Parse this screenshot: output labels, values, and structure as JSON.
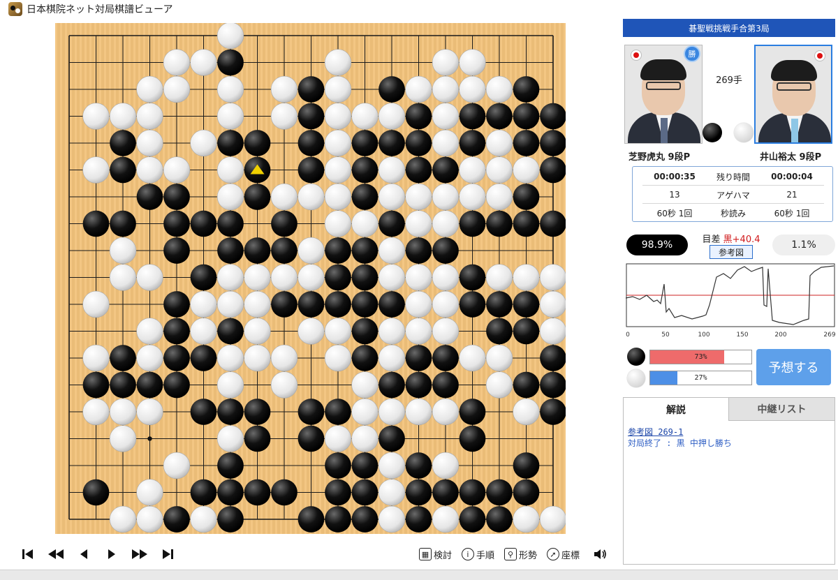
{
  "window": {
    "title": "日本棋院ネット対局棋譜ビューア",
    "icon": "go-board-icon"
  },
  "board": {
    "size": 19,
    "stones": [
      "......W............",
      "....WWB...W...WW...",
      "...WW.W.WBW.BWWWWB.",
      ".WWW..W.WBWWWBWBBBB",
      "..BW.WBB.BWBBBWBWBB",
      ".WBWW.WB.BWBWBBWWWB",
      "...BB.WBWWWBWWWWWB.",
      ".BB.BBB.B.WWBWWBBBBB",
      "..W.B.BBBWBBWBB.....",
      "..WW.BWWWWBBWWWBWWW.",
      ".W..BWWWBBBBBWWBBBW",
      "...WBWBW.WWBWWW.BBWB",
      ".WBWBBWWW.WBWBBWW.B.",
      ".BBBB.W.W..WBBB.WBB.",
      ".WWW.BBB.BBWWWWB.WB.",
      "..W...WB.BWWB..B.",
      "....W.B...BBWBW..B..",
      ".B.W.BBBB.BBWBBBBB.",
      "..WWBWB..BBBWBWBBWW",
      "..WWW.BW..BBWWBB..W",
      "....BBB...BWB.BBB.B"
    ],
    "last_move_marker": {
      "col": 7,
      "row": 5,
      "color": "#f0d000"
    },
    "hoshi": [
      [
        3,
        3
      ],
      [
        9,
        3
      ],
      [
        15,
        3
      ],
      [
        3,
        9
      ],
      [
        9,
        9
      ],
      [
        15,
        9
      ],
      [
        3,
        15
      ],
      [
        9,
        15
      ],
      [
        15,
        15
      ]
    ],
    "colors": {
      "wood": "#f2c27b",
      "line": "#1a1a1a"
    }
  },
  "controls": {
    "nav": [
      {
        "name": "first-move-button",
        "icon": "skip-start-icon"
      },
      {
        "name": "back-ten-button",
        "icon": "rewind-icon"
      },
      {
        "name": "back-one-button",
        "icon": "step-back-icon"
      },
      {
        "name": "forward-one-button",
        "icon": "play-icon"
      },
      {
        "name": "forward-ten-button",
        "icon": "fast-forward-icon"
      },
      {
        "name": "last-move-button",
        "icon": "skip-end-icon"
      }
    ],
    "tools": [
      {
        "name": "review-tool",
        "label": "検討",
        "icon": "grid-icon"
      },
      {
        "name": "move-order-tool",
        "label": "手順",
        "icon": "info-icon"
      },
      {
        "name": "situation-tool",
        "label": "形勢",
        "icon": "magnifier-icon"
      },
      {
        "name": "coordinates-tool",
        "label": "座標",
        "icon": "compass-icon"
      }
    ],
    "sound_icon": "speaker-icon"
  },
  "match": {
    "title": "碁聖戦挑戦手合第3局",
    "move_count": "269手",
    "black": {
      "name": "芝野虎丸 9段P",
      "win_badge": "勝",
      "flag_icon": "japan-flag-icon"
    },
    "white": {
      "name": "井山裕太 9段P",
      "flag_icon": "japan-flag-icon"
    }
  },
  "time": {
    "rows": [
      {
        "black": "00:00:35",
        "label": "残り時間",
        "white": "00:00:04"
      },
      {
        "black": "13",
        "label": "アゲハマ",
        "white": "21"
      },
      {
        "black": "60秒 1回",
        "label": "秒読み",
        "white": "60秒 1回"
      }
    ]
  },
  "evaluation": {
    "black_rate": "98.9%",
    "white_rate": "1.1%",
    "margin_label": "目差",
    "margin_value": "黒+40.4",
    "ref_button": "参考図",
    "graph": {
      "x_ticks": [
        "0",
        "50",
        "100",
        "150",
        "200",
        "269"
      ],
      "line_color": "#333333",
      "center_line_color": "#cc2222"
    }
  },
  "prediction": {
    "black_percent": 73,
    "black_label": "73%",
    "white_percent": 27,
    "white_label": "27%",
    "black_color": "#ee6b6b",
    "white_color": "#4d8fe6",
    "button": "予想する"
  },
  "comments": {
    "tabs": [
      "解説",
      "中継リスト"
    ],
    "link": "参考図 269-1",
    "text": "対局終了 : 黒 中押し勝ち"
  }
}
